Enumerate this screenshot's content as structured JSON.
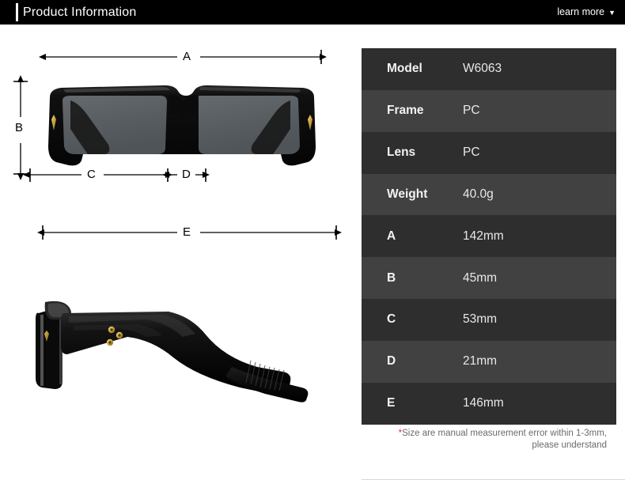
{
  "header": {
    "title": "Product Information",
    "learn_more_label": "learn more",
    "caret_glyph": "▼",
    "background_color": "#000000",
    "accent_color": "#ffffff"
  },
  "diagram": {
    "front_view_alt": "sunglasses-front-view",
    "side_view_alt": "sunglasses-side-view",
    "dimension_labels": {
      "a": "A",
      "b": "B",
      "c": "C",
      "d": "D",
      "e": "E"
    },
    "frame_color": "#0d0d0d",
    "lens_color": "#5a6063",
    "accent_metal_color": "#d4af37"
  },
  "spec_table": {
    "row_color_dark": "#2e2e2e",
    "row_color_light": "#414141",
    "rows": [
      {
        "label": "Model",
        "value": "W6063"
      },
      {
        "label": "Frame",
        "value": "PC"
      },
      {
        "label": "Lens",
        "value": "PC"
      },
      {
        "label": "Weight",
        "value": "40.0g"
      },
      {
        "label": "A",
        "value": "142mm"
      },
      {
        "label": "B",
        "value": "45mm"
      },
      {
        "label": "C",
        "value": "53mm"
      },
      {
        "label": "D",
        "value": "21mm"
      },
      {
        "label": "E",
        "value": "146mm"
      }
    ],
    "note_star": "*",
    "note_line1": "Size are manual measurement error within 1-3mm,",
    "note_line2": "please understand",
    "note_color": "#6b6b6b",
    "note_star_color": "#e03030"
  }
}
